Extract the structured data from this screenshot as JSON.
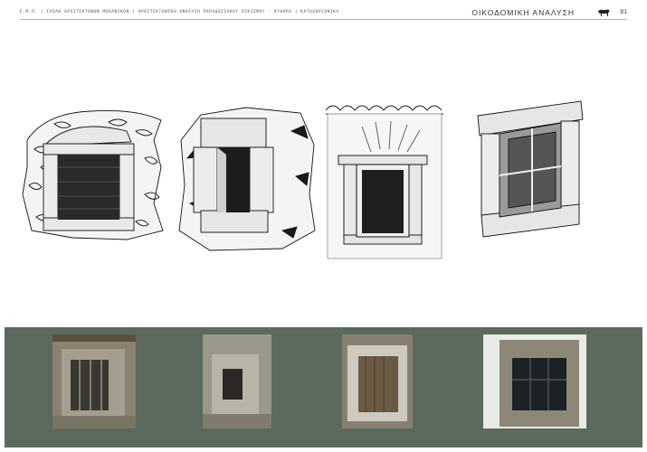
{
  "header": {
    "breadcrumb": "Ε.Μ.Π. | ΣΧΟΛΗ ΑΡΧΙΤΕΚΤΟΝΩΝ ΜΗΧΑΝΙΚΩΝ | ΑΡΧΙΤΕΚΤΟΝΙΚΗ ΑΝΑΛΥΣΗ ΠΑΡΑΔΟΣΙΑΚΟΥ ΟΙΚΙΣΜΟΥ - ΚΥΘΗΡΑ | ΚΑΤΟΧΩΡΙΑΝΙΚΑ",
    "section_title": "ΟΙΚΟΔΟΜΙΚΗ ΑΝΑΛΥΣΗ",
    "page_number": "81"
  },
  "colors": {
    "photo_band": "#5b6a5c",
    "ink": "#111111",
    "stone": "#8c877d"
  },
  "sketches": [
    {
      "icon": "rubble-stone-window-with-wooden-shutter"
    },
    {
      "icon": "dressed-stone-frame-window"
    },
    {
      "icon": "tiled-eave-plastered-window"
    },
    {
      "icon": "wooden-casement-window"
    }
  ],
  "photos": [
    {
      "icon": "photo-stone-window-with-bars"
    },
    {
      "icon": "photo-small-stone-opening"
    },
    {
      "icon": "photo-window-with-wooden-shutter"
    },
    {
      "icon": "photo-window-with-iron-grille"
    }
  ]
}
